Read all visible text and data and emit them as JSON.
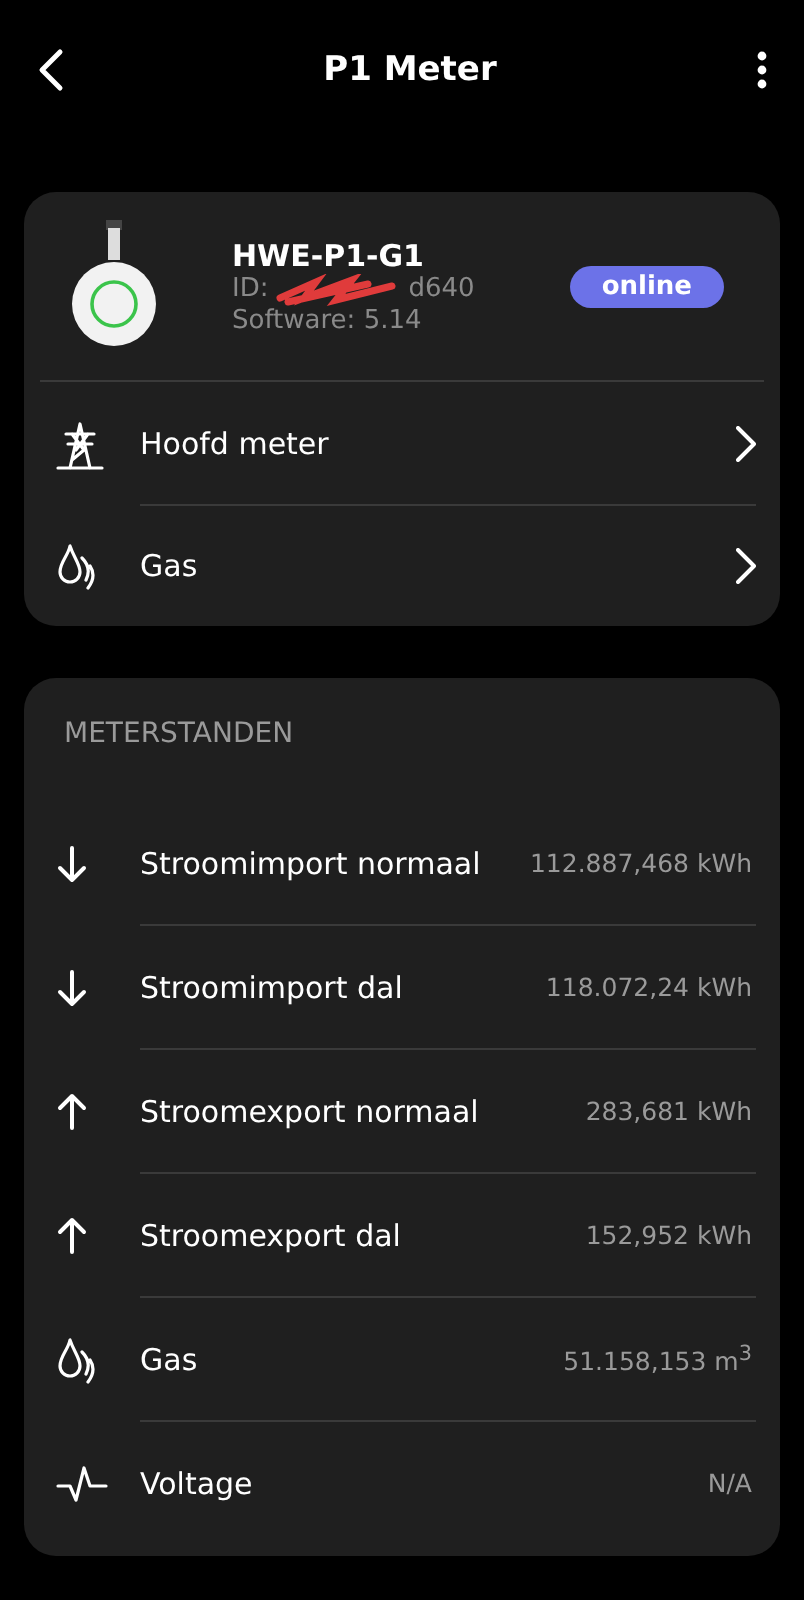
{
  "header": {
    "title": "P1 Meter"
  },
  "device": {
    "name": "HWE-P1-G1",
    "id_prefix": "ID:",
    "id_suffix": "d640",
    "software": "Software: 5.14",
    "status": "online"
  },
  "links": [
    {
      "label": "Hoofd meter",
      "kind": "pylon"
    },
    {
      "label": "Gas",
      "kind": "gas"
    }
  ],
  "readings": {
    "title": "METERSTANDEN",
    "rows": [
      {
        "label": "Stroomimport normaal",
        "value": "112.887,468 kWh",
        "kind": "down"
      },
      {
        "label": "Stroomimport dal",
        "value": "118.072,24 kWh",
        "kind": "down"
      },
      {
        "label": "Stroomexport normaal",
        "value": "283,681 kWh",
        "kind": "up"
      },
      {
        "label": "Stroomexport dal",
        "value": "152,952 kWh",
        "kind": "up"
      },
      {
        "label": "Gas",
        "value": "51.158,153 m$^{3}$",
        "kind": "gas"
      },
      {
        "label": "Voltage",
        "value": "N/A",
        "kind": "voltage"
      }
    ]
  }
}
